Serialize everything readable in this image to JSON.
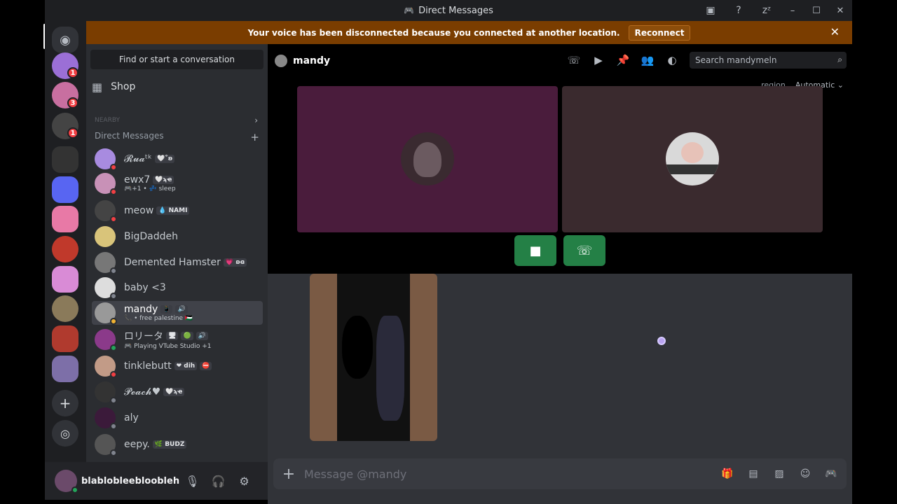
{
  "window": {
    "title": "Direct Messages",
    "controls": [
      "–",
      "☐",
      "✕"
    ]
  },
  "titlebar_icons": [
    "inbox-icon",
    "help-icon",
    "sleep-icon"
  ],
  "banner": {
    "message": "Your voice has been disconnected because you connected at another location.",
    "button": "Reconnect",
    "close": "✕"
  },
  "servers": [
    {
      "badge": "1",
      "color": "#9b6fd6"
    },
    {
      "badge": "3",
      "color": "#c86fa0"
    },
    {
      "badge": "1",
      "color": "#444"
    },
    {
      "badge": "",
      "color": "#333"
    },
    {
      "badge": "",
      "color": "#5865f2"
    },
    {
      "badge": "",
      "color": "#e879a6"
    },
    {
      "badge": "",
      "color": "#c0392b"
    },
    {
      "badge": "",
      "color": "#d98bd6"
    },
    {
      "badge": "",
      "color": "#8a7a5a"
    },
    {
      "badge": "",
      "color": "#b03a2e"
    },
    {
      "badge": "",
      "color": "#7d6fa8"
    }
  ],
  "sidebar": {
    "find": "Find or start a conversation",
    "shop": "Shop",
    "faded_label": "NEARBY",
    "dm_header": "Direct Messages",
    "add": "+",
    "dms": [
      {
        "name": "𝓡𝓾𝓪ᵗᵏ",
        "tags": [
          "🤍˚ʚ"
        ],
        "sub": "",
        "color": "#a88be0",
        "status": "#f23f43"
      },
      {
        "name": "ewx7",
        "tags": [
          "🤍ϡҽ"
        ],
        "sub": "🎮+1 • 💤 sleep",
        "color": "#c891b7",
        "status": "#f23f43"
      },
      {
        "name": "meow",
        "tags": [
          "💧 NAMI"
        ],
        "sub": "",
        "color": "#444",
        "status": "#f23f43"
      },
      {
        "name": "BigDaddeh",
        "tags": [],
        "sub": "",
        "color": "#d9c47a",
        "status": ""
      },
      {
        "name": "Demented Hamster",
        "tags": [
          "💗 ʚɞ"
        ],
        "sub": "",
        "color": "#777",
        "status": "#80848e"
      },
      {
        "name": "baby <3",
        "tags": [],
        "sub": "",
        "color": "#ddd",
        "status": "#80848e"
      },
      {
        "name": "mandy",
        "tags": [
          "📱",
          "🔊"
        ],
        "sub": "📞 • free palestine 🇵🇸",
        "color": "#999",
        "status": "#f0b232"
      },
      {
        "name": "ロリータ",
        "tags": [
          "🖥",
          "🟢",
          "🔊"
        ],
        "sub": "🎮 Playing VTube Studio +1",
        "color": "#8b3a8a",
        "status": "#23a55a"
      },
      {
        "name": "tinklebutt",
        "tags": [
          "❤ dih",
          "⛔"
        ],
        "sub": "",
        "color": "#c29b87",
        "status": "#f23f43"
      },
      {
        "name": "𝓟𝓮𝓪𝓬𝓱♥",
        "tags": [
          "🤍ϡҽ"
        ],
        "sub": "",
        "color": "#333",
        "status": "#80848e"
      },
      {
        "name": "aly",
        "tags": [],
        "sub": "",
        "color": "#3b1a3a",
        "status": "#80848e"
      },
      {
        "name": "eepy.",
        "tags": [
          "🌿 BUDZ"
        ],
        "sub": "",
        "color": "#555",
        "status": "#80848e"
      }
    ]
  },
  "user": {
    "name": "blablobleeblooblеh...",
    "icons": [
      "mic-icon",
      "headphones-icon",
      "settings-icon"
    ]
  },
  "channel": {
    "name": "mandy",
    "header_icons": [
      "phone-icon",
      "video-icon",
      "pin-icon",
      "add-friend-icon",
      "profile-icon"
    ],
    "search_placeholder": "Search mandymeln"
  },
  "call": {
    "region_label": "region",
    "region_value": "Automatic ⌄",
    "tiles": [
      {
        "bg": "#4a1c3c"
      },
      {
        "bg": "#3a2a2e"
      }
    ],
    "buttons": [
      "join-video-button",
      "join-voice-button"
    ]
  },
  "composer": {
    "placeholder": "Message @mandy",
    "icons": [
      "gift-icon",
      "gif-icon",
      "sticker-icon",
      "emoji-icon",
      "activity-icon"
    ]
  }
}
